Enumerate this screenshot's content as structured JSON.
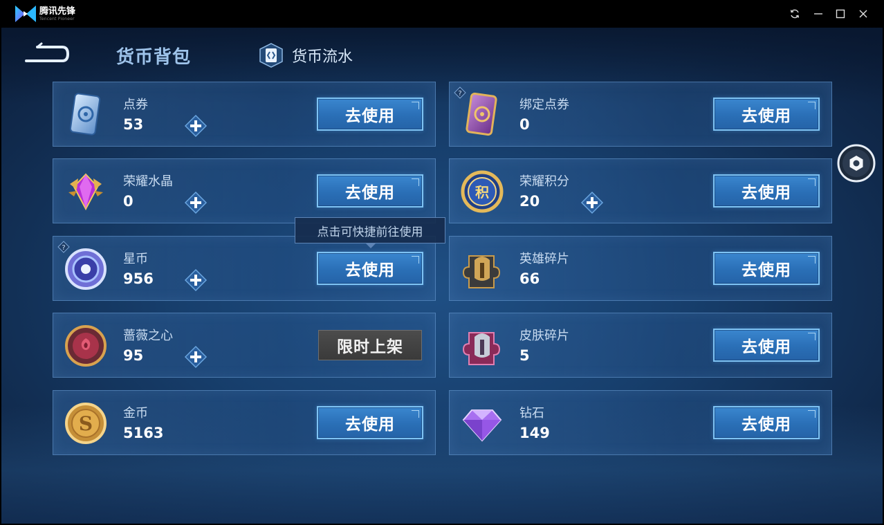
{
  "window": {
    "app_name": "腾讯先锋",
    "app_sub": "Tencent Pioneer",
    "icons": [
      "refresh-icon",
      "minimize-icon",
      "maximize-icon",
      "close-icon"
    ]
  },
  "header": {
    "title": "货币背包",
    "flow_tab_label": "货币流水"
  },
  "tooltip": "点击可快捷前往使用",
  "colors": {
    "accent_button": "#2a6fb6",
    "button_border": "#7ec3f4",
    "title": "#9ec3ea",
    "disabled_button": "#3a3a3a"
  },
  "cards": [
    {
      "name": "点券",
      "value": "53",
      "button": "去使用",
      "has_plus": true,
      "has_help": false,
      "icon": "voucher-card-icon"
    },
    {
      "name": "绑定点券",
      "value": "0",
      "button": "去使用",
      "has_plus": false,
      "has_help": true,
      "icon": "bound-voucher-card-icon"
    },
    {
      "name": "荣耀水晶",
      "value": "0",
      "button": "去使用",
      "has_plus": true,
      "has_help": false,
      "icon": "glory-crystal-icon"
    },
    {
      "name": "荣耀积分",
      "value": "20",
      "button": "去使用",
      "has_plus": true,
      "has_help": false,
      "icon": "glory-points-icon"
    },
    {
      "name": "星币",
      "value": "956",
      "button": "去使用",
      "has_plus": true,
      "has_help": true,
      "icon": "star-coin-icon"
    },
    {
      "name": "英雄碎片",
      "value": "66",
      "button": "去使用",
      "has_plus": false,
      "has_help": false,
      "icon": "hero-fragment-icon"
    },
    {
      "name": "蔷薇之心",
      "value": "95",
      "button": "限时上架",
      "has_plus": true,
      "has_help": false,
      "icon": "rose-heart-icon"
    },
    {
      "name": "皮肤碎片",
      "value": "5",
      "button": "去使用",
      "has_plus": false,
      "has_help": false,
      "icon": "skin-fragment-icon"
    },
    {
      "name": "金币",
      "value": "5163",
      "button": "去使用",
      "has_plus": false,
      "has_help": false,
      "icon": "gold-coin-icon"
    },
    {
      "name": "钻石",
      "value": "149",
      "button": "去使用",
      "has_plus": false,
      "has_help": false,
      "icon": "diamond-icon"
    }
  ]
}
